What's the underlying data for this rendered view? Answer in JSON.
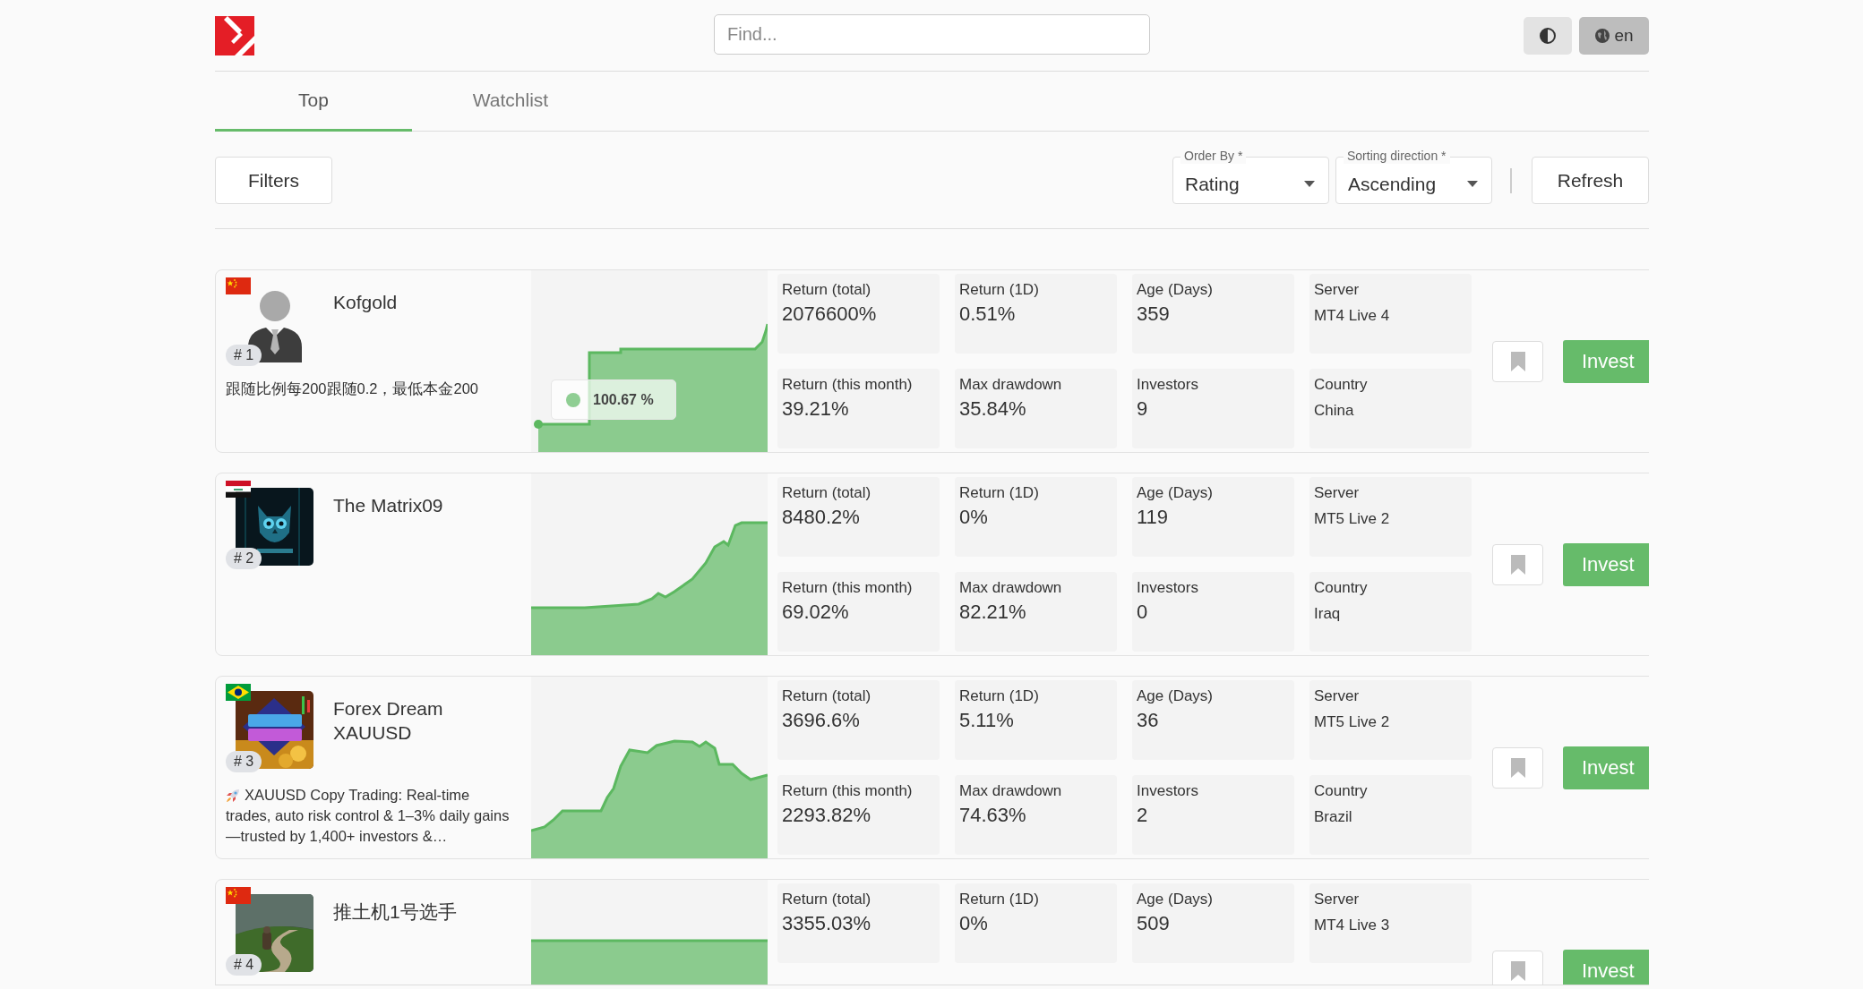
{
  "header": {
    "search": {
      "placeholder": "Find..."
    },
    "language": "en"
  },
  "tabs": [
    {
      "label": "Top",
      "selected": true
    },
    {
      "label": "Watchlist",
      "selected": false
    }
  ],
  "toolbar": {
    "filters": "Filters",
    "order_by": {
      "label": "Order By *",
      "value": "Rating"
    },
    "sorting_direction": {
      "label": "Sorting direction *",
      "value": "Ascending"
    },
    "refresh": "Refresh"
  },
  "traders": [
    {
      "flag": {
        "kind": "china"
      },
      "avatar": {
        "kind": "silhouette"
      },
      "rank": "# 1",
      "name": "Kofgold",
      "description": "跟随比例每200跟随0.2，最低本金200",
      "tooltip": "100.67 %",
      "stats": [
        {
          "kind": "figure",
          "label": "Return (total)",
          "value": "2076600%"
        },
        {
          "kind": "figure",
          "label": "Return (1D)",
          "value": "0.51%"
        },
        {
          "kind": "figure",
          "label": "Age (Days)",
          "value": "359"
        },
        {
          "kind": "info",
          "label": "Server",
          "value": "MT4 Live 4"
        },
        {
          "kind": "figure",
          "label": "Return (this month)",
          "value": "39.21%"
        },
        {
          "kind": "figure",
          "label": "Max drawdown",
          "value": "35.84%"
        },
        {
          "kind": "figure",
          "label": "Investors",
          "value": "9"
        },
        {
          "kind": "info",
          "label": "Country",
          "value": "China"
        }
      ],
      "invest": "Invest"
    },
    {
      "flag": {
        "kind": "iraq"
      },
      "avatar": {
        "kind": "owl"
      },
      "rank": "# 2",
      "name": "The Matrix09",
      "stats": [
        {
          "kind": "figure",
          "label": "Return (total)",
          "value": "8480.2%"
        },
        {
          "kind": "figure",
          "label": "Return (1D)",
          "value": "0%"
        },
        {
          "kind": "figure",
          "label": "Age (Days)",
          "value": "119"
        },
        {
          "kind": "info",
          "label": "Server",
          "value": "MT5 Live 2"
        },
        {
          "kind": "figure",
          "label": "Return (this month)",
          "value": "69.02%"
        },
        {
          "kind": "figure",
          "label": "Max drawdown",
          "value": "82.21%"
        },
        {
          "kind": "figure",
          "label": "Investors",
          "value": "0"
        },
        {
          "kind": "info",
          "label": "Country",
          "value": "Iraq"
        }
      ],
      "invest": "Invest"
    },
    {
      "flag": {
        "kind": "brazil"
      },
      "avatar": {
        "kind": "gold"
      },
      "rank": "# 3",
      "name": "Forex Dream XAUUSD",
      "lead_icon": {
        "kind": "rocket"
      },
      "description": "XAUUSD Copy Trading: Real-time trades, auto risk control & 1–3% daily gains—trusted by 1,400+ investors &…",
      "stats": [
        {
          "kind": "figure",
          "label": "Return (total)",
          "value": "3696.6%"
        },
        {
          "kind": "figure",
          "label": "Return (1D)",
          "value": "5.11%"
        },
        {
          "kind": "figure",
          "label": "Age (Days)",
          "value": "36"
        },
        {
          "kind": "info",
          "label": "Server",
          "value": "MT5 Live 2"
        },
        {
          "kind": "figure",
          "label": "Return (this month)",
          "value": "2293.82%"
        },
        {
          "kind": "figure",
          "label": "Max drawdown",
          "value": "74.63%"
        },
        {
          "kind": "figure",
          "label": "Investors",
          "value": "2"
        },
        {
          "kind": "info",
          "label": "Country",
          "value": "Brazil"
        }
      ],
      "invest": "Invest"
    },
    {
      "flag": {
        "kind": "china"
      },
      "avatar": {
        "kind": "road"
      },
      "rank": "# 4",
      "name": "推土机1号选手",
      "stats": [
        {
          "kind": "figure",
          "label": "Return (total)",
          "value": "3355.03%"
        },
        {
          "kind": "figure",
          "label": "Return (1D)",
          "value": "0%"
        },
        {
          "kind": "figure",
          "label": "Age (Days)",
          "value": "509"
        },
        {
          "kind": "info",
          "label": "Server",
          "value": "MT4 Live 3"
        }
      ],
      "invest": "Invest"
    }
  ]
}
